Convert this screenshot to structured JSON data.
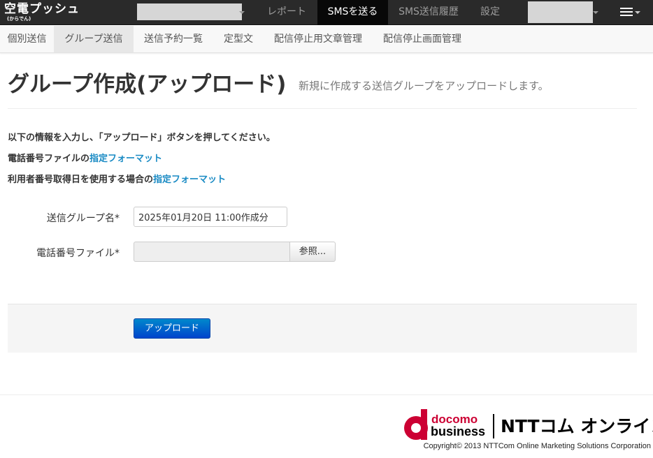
{
  "brand": {
    "name": "空電プッシュ",
    "reading": "(からでん)"
  },
  "topnav": {
    "items": [
      {
        "label": "レポート"
      },
      {
        "label": "SMSを送る"
      },
      {
        "label": "SMS送信履歴"
      },
      {
        "label": "設定"
      }
    ]
  },
  "subnav": {
    "items": [
      {
        "label": "個別送信"
      },
      {
        "label": "グループ送信"
      },
      {
        "label": "送信予約一覧"
      },
      {
        "label": "定型文"
      },
      {
        "label": "配信停止用文章管理"
      },
      {
        "label": "配信停止画面管理"
      }
    ]
  },
  "page": {
    "title": "グループ作成(アップロード)",
    "subtitle": "新規に作成する送信グループをアップロードします。"
  },
  "instructions": {
    "line1": "以下の情報を入力し、「アップロード」ボタンを押してください。",
    "line2_prefix": "電話番号ファイルの",
    "line2_link": "指定フォーマット",
    "line3_prefix": "利用者番号取得日を使用する場合の",
    "line3_link": "指定フォーマット"
  },
  "form": {
    "group_name_label": "送信グループ名*",
    "group_name_value": "2025年01月20日 11:00作成分",
    "phone_file_label": "電話番号ファイル*",
    "browse_label": "参照...",
    "upload_label": "アップロード"
  },
  "footer": {
    "docomo": "docomo",
    "business": "business",
    "ntt": "NTTコム オンライン",
    "copyright": "Copyright© 2013 NTTCom Online Marketing Solutions Corporation"
  },
  "colors": {
    "navbar": "#2a2a2a",
    "link": "#1a8bc4",
    "primary": "#0066cc",
    "docomo_red": "#cc0033"
  }
}
